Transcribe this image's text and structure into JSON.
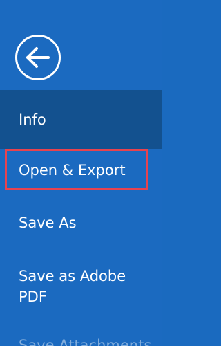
{
  "backstage": {
    "back_icon": "arrow-left-icon",
    "items": [
      {
        "label": "Info",
        "selected": true
      },
      {
        "label": "Open & Export",
        "highlighted": true
      },
      {
        "label": "Save As"
      },
      {
        "label": "Save as Adobe PDF"
      },
      {
        "label": "Save Attachments"
      }
    ]
  },
  "colors": {
    "nav_background": "#1b6ac0",
    "selected_background": "#13518f",
    "highlight_border": "#e8434f",
    "text": "#ffffff"
  }
}
